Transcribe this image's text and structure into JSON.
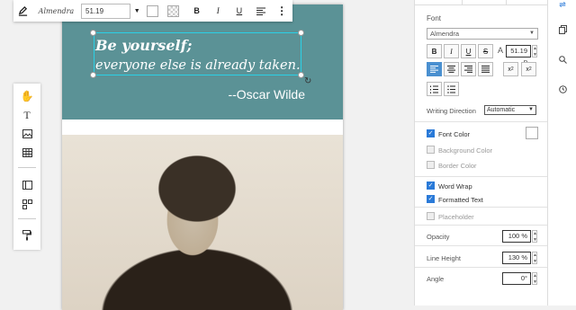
{
  "canvas": {
    "quote_line1": "Be yourself;",
    "quote_line2": "everyone else is already taken.",
    "author": "--Oscar Wilde"
  },
  "toolbar": {
    "font_name": "Almendra",
    "font_size": "51.19",
    "bold": "B",
    "italic": "I",
    "underline": "U",
    "align_icon": "align-icon",
    "more_icon": "more-vertical-icon"
  },
  "left_tools": [
    "hand-icon",
    "text-icon",
    "image-icon",
    "table-icon",
    "layout-icon",
    "arrange-icon",
    "paint-roller-icon"
  ],
  "panel": {
    "font_heading": "Font",
    "font_select": "Almendra",
    "style_buttons": [
      "B",
      "I",
      "U",
      "S"
    ],
    "font_size_value": "51.19 p",
    "writing_direction_label": "Writing Direction",
    "writing_direction_value": "Automatic",
    "font_color_label": "Font Color",
    "background_color_label": "Background Color",
    "border_color_label": "Border Color",
    "word_wrap_label": "Word Wrap",
    "formatted_text_label": "Formatted Text",
    "placeholder_label": "Placeholder",
    "opacity_label": "Opacity",
    "opacity_value": "100 %",
    "line_height_label": "Line Height",
    "line_height_value": "130 %",
    "angle_label": "Angle",
    "angle_value": "0°"
  },
  "checks": {
    "font_color": true,
    "background_color": false,
    "border_color": false,
    "word_wrap": true,
    "formatted_text": true,
    "placeholder": false
  },
  "colors": {
    "banner": "#5b9296",
    "accent": "#4a90d0",
    "checkbox": "#2a7ad8",
    "selection": "#2bd0e6"
  }
}
